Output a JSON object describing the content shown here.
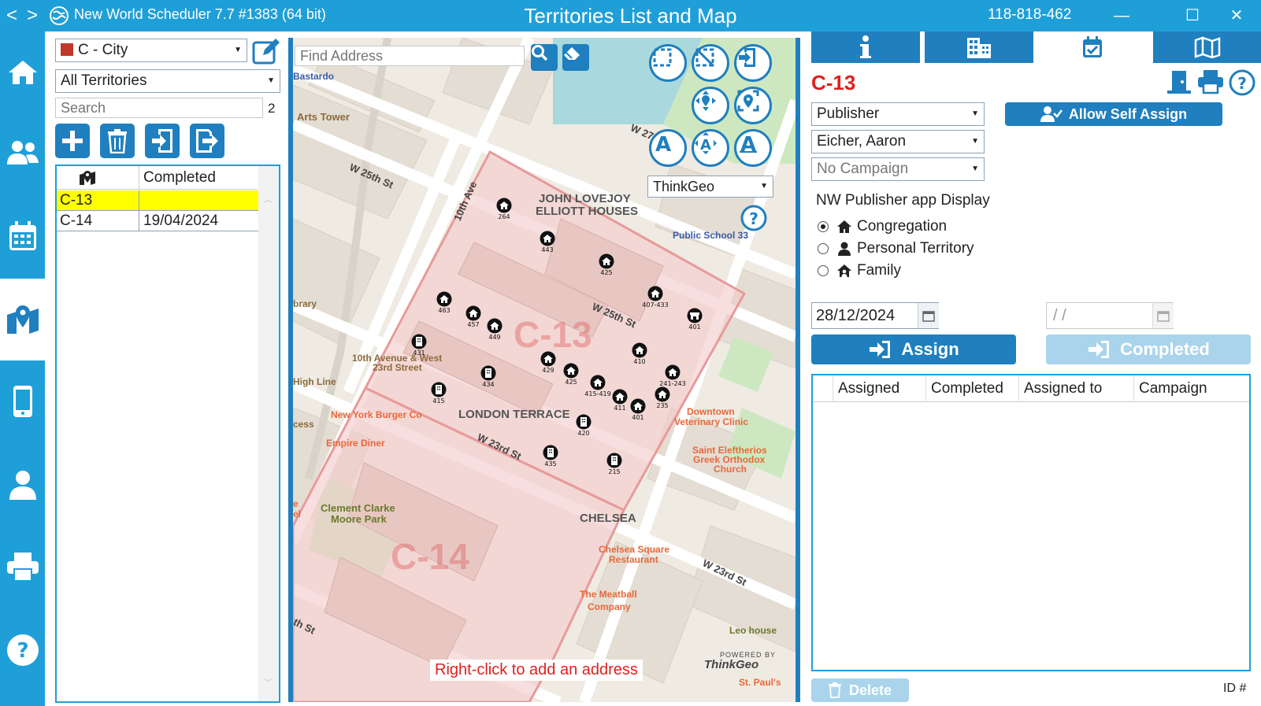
{
  "titlebar": {
    "back": "<",
    "forward": ">",
    "app_title": "New World Scheduler 7.7 #1383 (64 bit)",
    "window_title": "Territories List and Map",
    "identifier": "118-818-462",
    "minimize": "—",
    "maximize": "☐",
    "close": "✕"
  },
  "rail": {
    "items": [
      {
        "name": "home",
        "icon": "home-icon"
      },
      {
        "name": "people",
        "icon": "people-icon"
      },
      {
        "name": "calendar",
        "icon": "calendar-icon"
      },
      {
        "name": "territories",
        "icon": "map-pin-icon",
        "active": true
      },
      {
        "name": "mobile",
        "icon": "mobile-icon"
      },
      {
        "name": "person",
        "icon": "person-icon"
      },
      {
        "name": "print",
        "icon": "printer-icon"
      },
      {
        "name": "help",
        "icon": "help-icon"
      }
    ]
  },
  "territories_panel": {
    "type_select": "C - City",
    "type_color": "#c0392b",
    "filter_select": "All Territories",
    "search_placeholder": "Search",
    "count": "2",
    "list": {
      "headers": [
        "",
        "Completed"
      ],
      "rows": [
        {
          "name": "C-13",
          "completed": "",
          "selected": true
        },
        {
          "name": "C-14",
          "completed": "19/04/2024",
          "selected": false
        }
      ]
    }
  },
  "map": {
    "find_address_placeholder": "Find Address",
    "provider_select": "ThinkGeo",
    "hint": "Right-click to add an address",
    "powered_by": "POWERED BY",
    "powered_brand": "ThinkGeo",
    "labels": {
      "bastardo": "Bastardo",
      "arts_tower": "Arts Tower",
      "w25th_a": "W 25th St",
      "w25th_b": "W 25th St",
      "w27": "W 27",
      "tenth_ave": "10th Ave",
      "john_lovejoy_1": "JOHN LOVEJOY",
      "john_lovejoy_2": "ELLIOTT HOUSES",
      "public_school": "Public School 33",
      "library": "brary",
      "tenth_west_1": "10th Avenue & West",
      "tenth_west_2": "23rd Street",
      "high_line": "High Line",
      "ny_burger": "New York Burger Co",
      "cess": "cess",
      "empire_diner": "Empire Diner",
      "london_terrace": "LONDON TERRACE",
      "w23rd_a": "W 23rd St",
      "w23rd_b": "W 23rd St",
      "downtown_vet_1": "Downtown",
      "downtown_vet_2": "Veterinary Clinic",
      "saint_1": "Saint Eleftherios",
      "saint_2": "Greek Orthodox",
      "saint_3": "Church",
      "clement_1": "Clement Clarke",
      "clement_2": "Moore Park",
      "chelsea": "CHELSEA",
      "chelsea_sq_1": "Chelsea Square",
      "chelsea_sq_2": "Restaurant",
      "meatball_1": "The Meatball",
      "meatball_2": "Company",
      "leo_house": "Leo house",
      "st_pauls": "St. Paul's",
      "h_st": "th St",
      "el": "el",
      "e": "e",
      "territory_c13": "C-13",
      "territory_c14": "C-14"
    },
    "markers": [
      {
        "label": "264",
        "kind": "house"
      },
      {
        "label": "443",
        "kind": "house"
      },
      {
        "label": "425",
        "kind": "house"
      },
      {
        "label": "407-433",
        "kind": "house"
      },
      {
        "label": "401",
        "kind": "store"
      },
      {
        "label": "463",
        "kind": "house"
      },
      {
        "label": "457",
        "kind": "house"
      },
      {
        "label": "449",
        "kind": "house"
      },
      {
        "label": "431",
        "kind": "building"
      },
      {
        "label": "434",
        "kind": "building"
      },
      {
        "label": "429",
        "kind": "house"
      },
      {
        "label": "425",
        "kind": "house"
      },
      {
        "label": "415-419",
        "kind": "house"
      },
      {
        "label": "411",
        "kind": "house"
      },
      {
        "label": "410",
        "kind": "house"
      },
      {
        "label": "241-243",
        "kind": "house"
      },
      {
        "label": "235",
        "kind": "house"
      },
      {
        "label": "401",
        "kind": "house"
      },
      {
        "label": "415",
        "kind": "building"
      },
      {
        "label": "420",
        "kind": "building"
      },
      {
        "label": "435",
        "kind": "building"
      },
      {
        "label": "215",
        "kind": "building"
      }
    ]
  },
  "detail_panel": {
    "tabs": [
      {
        "name": "info",
        "icon": "info-icon",
        "active": false
      },
      {
        "name": "buildings",
        "icon": "building-icon",
        "active": false
      },
      {
        "name": "assignments",
        "icon": "calendar-check-icon",
        "active": true
      },
      {
        "name": "map",
        "icon": "map-icon",
        "active": false
      }
    ],
    "territory_title": "C-13",
    "publisher_type_select": "Publisher",
    "publisher_select": "Eicher, Aaron",
    "campaign_select": "No Campaign",
    "allow_self_assign": "Allow Self Assign",
    "nw_display_label": "NW Publisher app Display",
    "display_options": [
      {
        "label": "Congregation",
        "icon": "home-icon",
        "checked": true
      },
      {
        "label": "Personal Territory",
        "icon": "person-icon",
        "checked": false
      },
      {
        "label": "Family",
        "icon": "family-home-icon",
        "checked": false
      }
    ],
    "assign_date": "28/12/2024",
    "completed_date": " / /",
    "assign_button": "Assign",
    "completed_button": "Completed",
    "grid_headers": [
      "Assigned",
      "Completed",
      "Assigned to",
      "Campaign"
    ],
    "delete_button": "Delete",
    "id_label": "ID #"
  },
  "colors": {
    "accent": "#1f9fd8",
    "accent_dark": "#1f7fbf",
    "territory_red": "#e02020",
    "selected_row": "#ffff00"
  }
}
